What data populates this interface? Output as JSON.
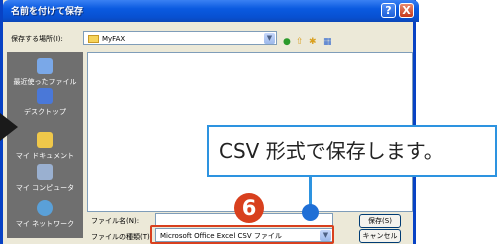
{
  "dialog": {
    "title": "名前を付けて保存",
    "help_label": "?",
    "close_label": "X"
  },
  "save_in": {
    "label": "保存する場所(I):",
    "value": "MyFAX"
  },
  "toolbar": {
    "back_icon": "back-icon",
    "up_icon": "up-folder-icon",
    "new_folder_icon": "new-folder-icon",
    "views_icon": "views-menu-icon"
  },
  "places": [
    {
      "label": "最近使ったファイル",
      "icon": "recent-icon",
      "color": "#7aa8e8"
    },
    {
      "label": "デスクトップ",
      "icon": "desktop-icon",
      "color": "#4a78d8"
    },
    {
      "label": "マイ ドキュメント",
      "icon": "my-documents-icon",
      "color": "#f0c84a"
    },
    {
      "label": "マイ コンピュータ",
      "icon": "my-computer-icon",
      "color": "#9ab0d0"
    },
    {
      "label": "マイ ネットワーク",
      "icon": "my-network-icon",
      "color": "#5aa0d8"
    }
  ],
  "file_name": {
    "label": "ファイル名(N):",
    "value": ""
  },
  "file_type": {
    "label": "ファイルの種類(T):",
    "value": "Microsoft Office Excel CSV ファイル"
  },
  "buttons": {
    "save": "保存(S)",
    "cancel": "キャンセル"
  },
  "annotation": {
    "callout_text": "CSV 形式で保存します。",
    "step_number": "6",
    "accent_color": "#d8401e",
    "callout_color": "#2d93e0"
  }
}
